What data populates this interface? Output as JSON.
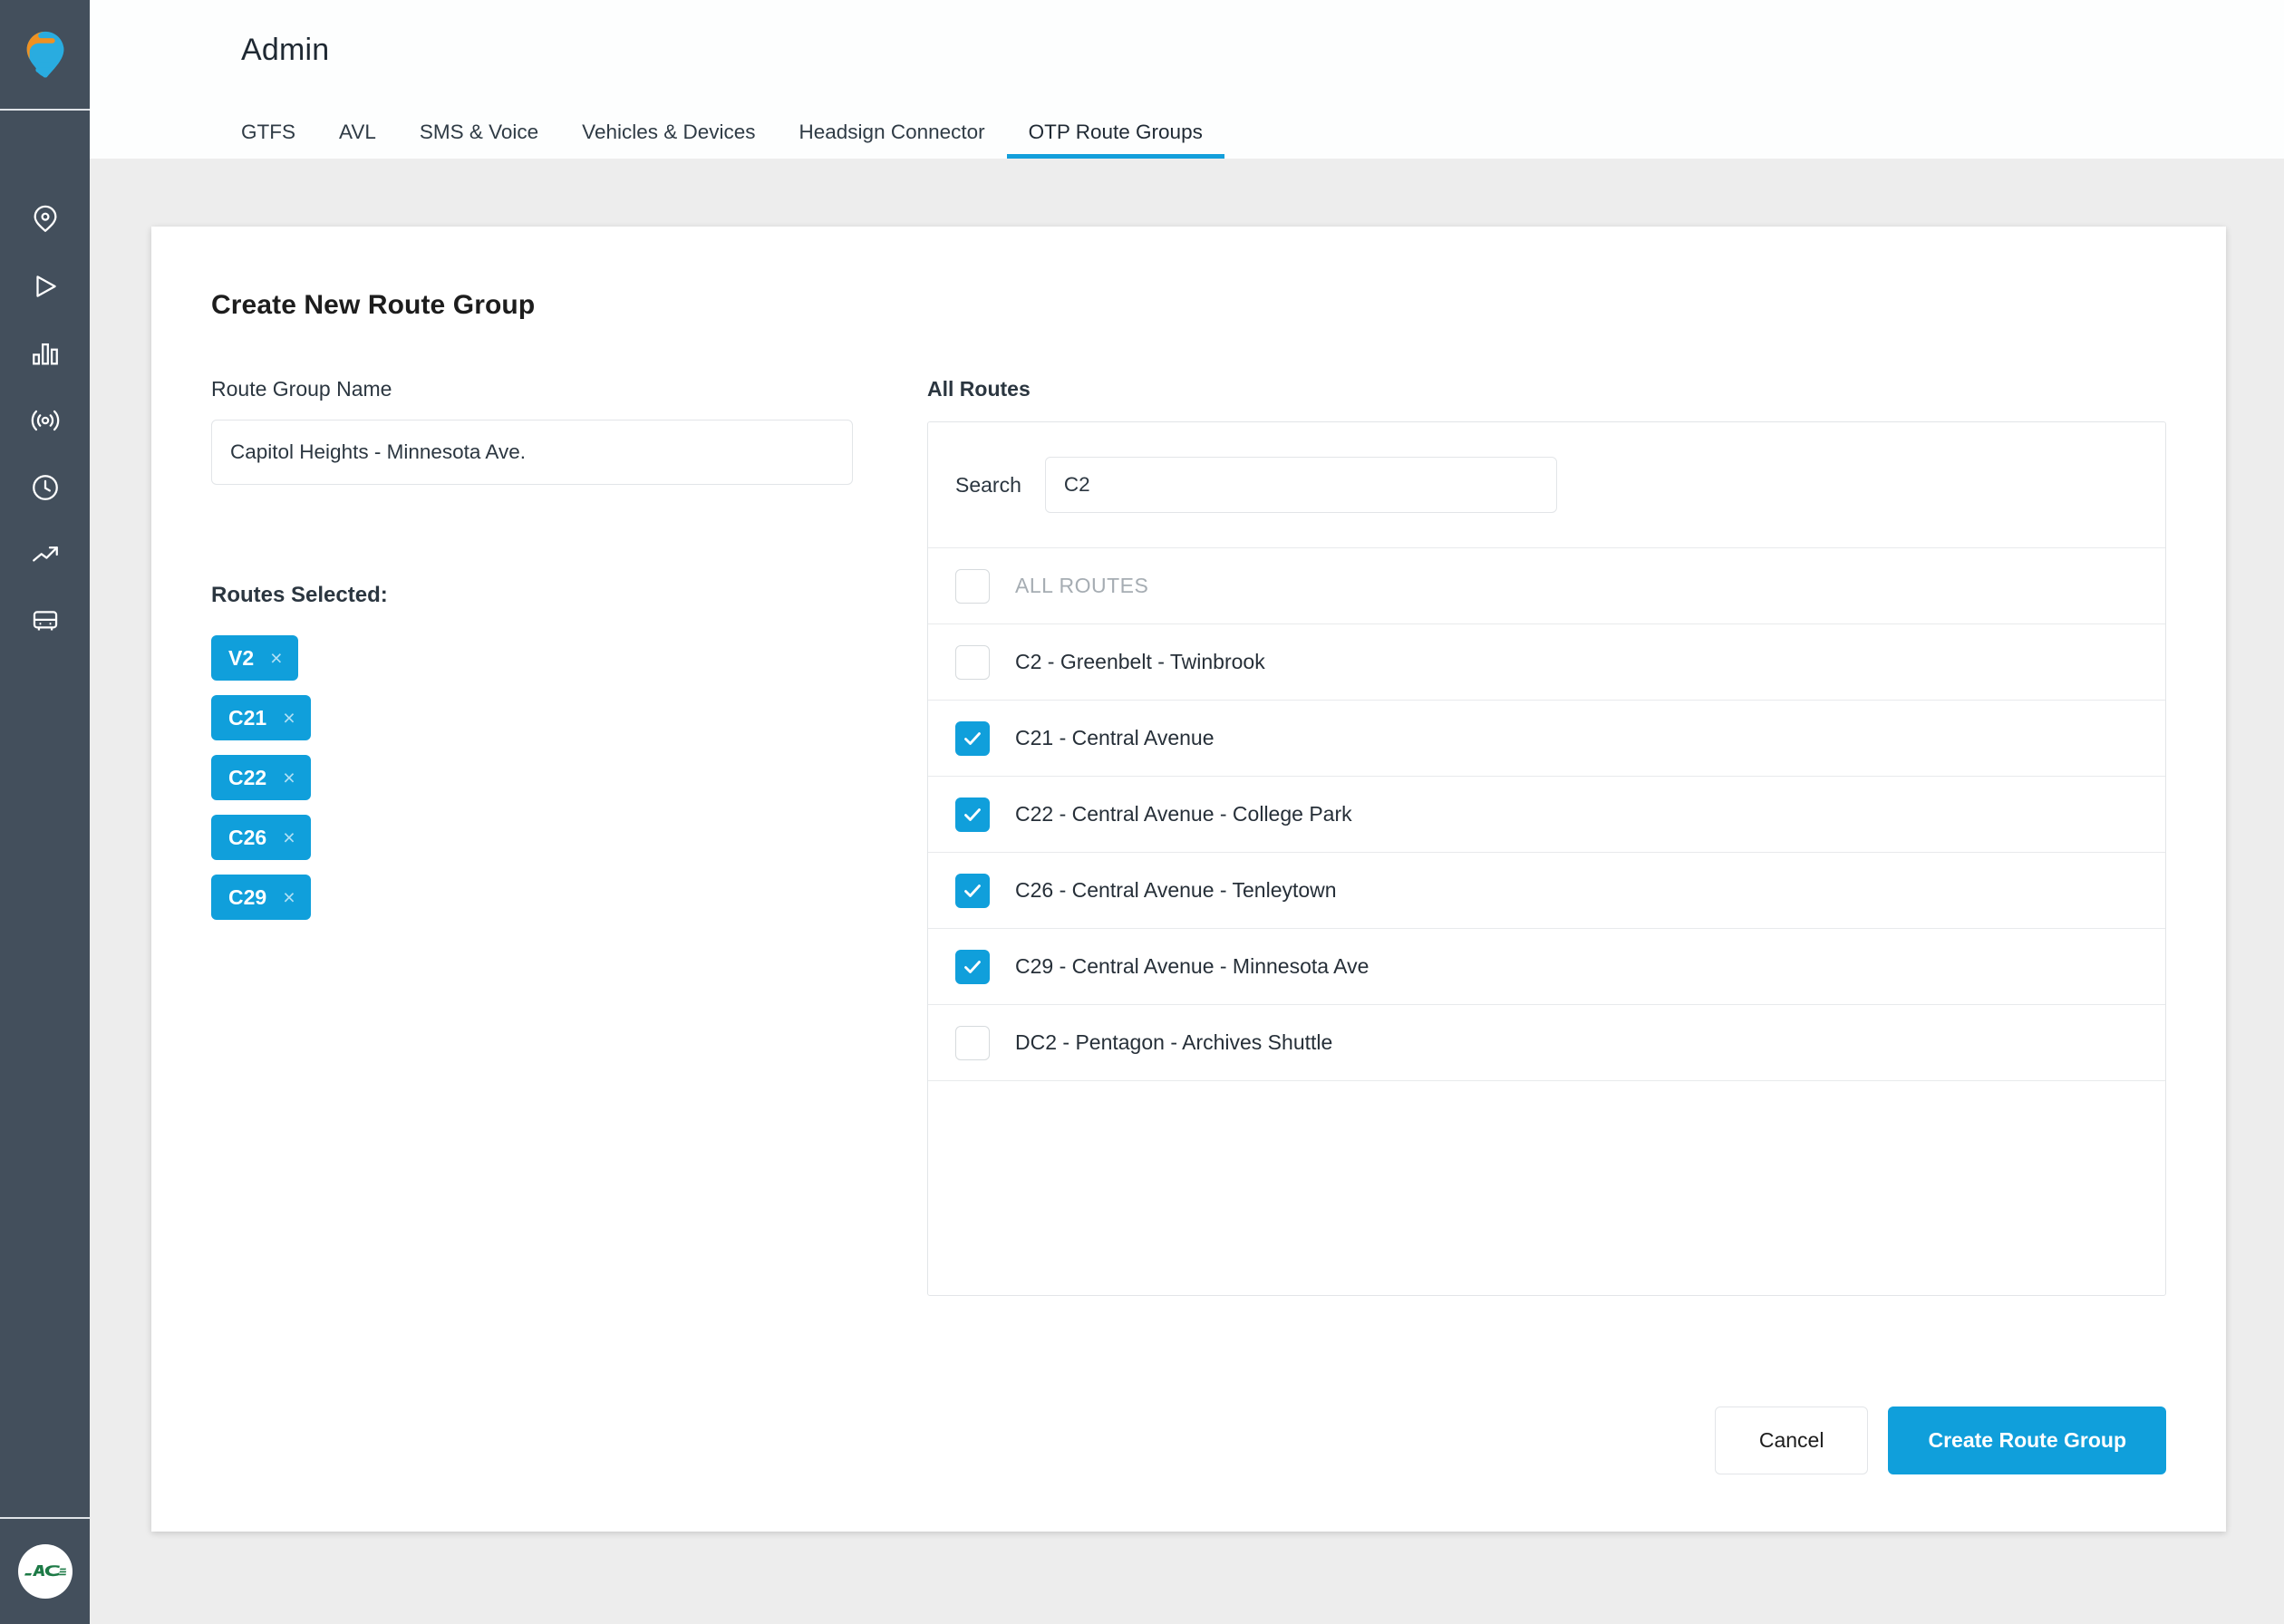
{
  "sidebar": {
    "logo_name": "swiftly-logo",
    "items": [
      {
        "icon": "map-pin-icon",
        "label": "Map"
      },
      {
        "icon": "play-icon",
        "label": "Playback"
      },
      {
        "icon": "bar-chart-icon",
        "label": "Reports"
      },
      {
        "icon": "broadcast-icon",
        "label": "Live"
      },
      {
        "icon": "clock-icon",
        "label": "Schedule"
      },
      {
        "icon": "trending-up-icon",
        "label": "Trends"
      },
      {
        "icon": "bus-icon",
        "label": "Vehicles"
      }
    ],
    "avatar": {
      "name": "account-avatar",
      "text": "AC TRANSIT"
    }
  },
  "header": {
    "title": "Admin",
    "tabs": [
      {
        "label": "GTFS",
        "active": false
      },
      {
        "label": "AVL",
        "active": false
      },
      {
        "label": "SMS & Voice",
        "active": false
      },
      {
        "label": "Vehicles & Devices",
        "active": false
      },
      {
        "label": "Headsign Connector",
        "active": false
      },
      {
        "label": "OTP Route Groups",
        "active": true
      }
    ]
  },
  "card": {
    "title": "Create New Route Group",
    "name_field": {
      "label": "Route Group Name",
      "value": "Capitol Heights - Minnesota Ave.",
      "placeholder": ""
    },
    "routes_selected": {
      "label": "Routes Selected:",
      "chips": [
        {
          "label": "V2",
          "remove": "×"
        },
        {
          "label": "C21",
          "remove": "×"
        },
        {
          "label": "C22",
          "remove": "×"
        },
        {
          "label": "C26",
          "remove": "×"
        },
        {
          "label": "C29",
          "remove": "×"
        }
      ]
    },
    "all_routes": {
      "label": "All Routes",
      "search": {
        "label": "Search",
        "value": "C2",
        "placeholder": ""
      },
      "select_all": {
        "label": "ALL ROUTES",
        "checked": false
      },
      "rows": [
        {
          "label": "C2 - Greenbelt - Twinbrook",
          "checked": false
        },
        {
          "label": "C21 - Central Avenue",
          "checked": true
        },
        {
          "label": "C22 - Central Avenue - College Park",
          "checked": true
        },
        {
          "label": "C26 - Central Avenue - Tenleytown",
          "checked": true
        },
        {
          "label": "C29 - Central Avenue - Minnesota Ave",
          "checked": true
        },
        {
          "label": "DC2 - Pentagon - Archives Shuttle",
          "checked": false
        }
      ]
    },
    "actions": {
      "cancel_label": "Cancel",
      "create_label": "Create Route Group"
    }
  },
  "colors": {
    "accent": "#109fdb",
    "sidebar_bg": "#434f5c",
    "page_bg": "#ededed",
    "logo_orange": "#ef9122",
    "logo_blue": "#29ace0",
    "avatar_green": "#1d7a46"
  }
}
